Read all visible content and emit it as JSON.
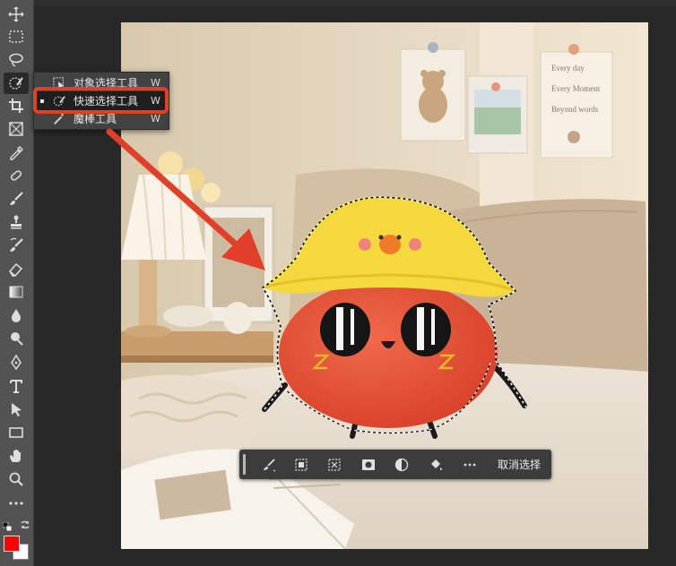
{
  "flyout": {
    "items": [
      {
        "label": "对象选择工具",
        "shortcut": "W"
      },
      {
        "label": "快速选择工具",
        "shortcut": "W"
      },
      {
        "label": "魔棒工具",
        "shortcut": "W"
      }
    ]
  },
  "context_bar": {
    "deselect_label": "取消选择"
  },
  "photo": {
    "frame_line1": "Every day",
    "frame_line2": "Every Moment",
    "frame_line3": "Beyond words"
  },
  "colors": {
    "foreground": "#ff0000",
    "background": "#ffffff",
    "highlight_annotation": "#e0402a"
  },
  "toolbar": {
    "tools": [
      "move-tool",
      "marquee-tool",
      "lasso-tool",
      "quick-select-tool",
      "crop-tool",
      "frame-tool",
      "eyedropper-tool",
      "healing-brush-tool",
      "brush-tool",
      "clone-stamp-tool",
      "history-brush-tool",
      "eraser-tool",
      "gradient-tool",
      "blur-tool",
      "dodge-tool",
      "pen-tool",
      "type-tool",
      "path-selection-tool",
      "rectangle-tool",
      "hand-tool",
      "zoom-tool",
      "more-tools"
    ]
  }
}
